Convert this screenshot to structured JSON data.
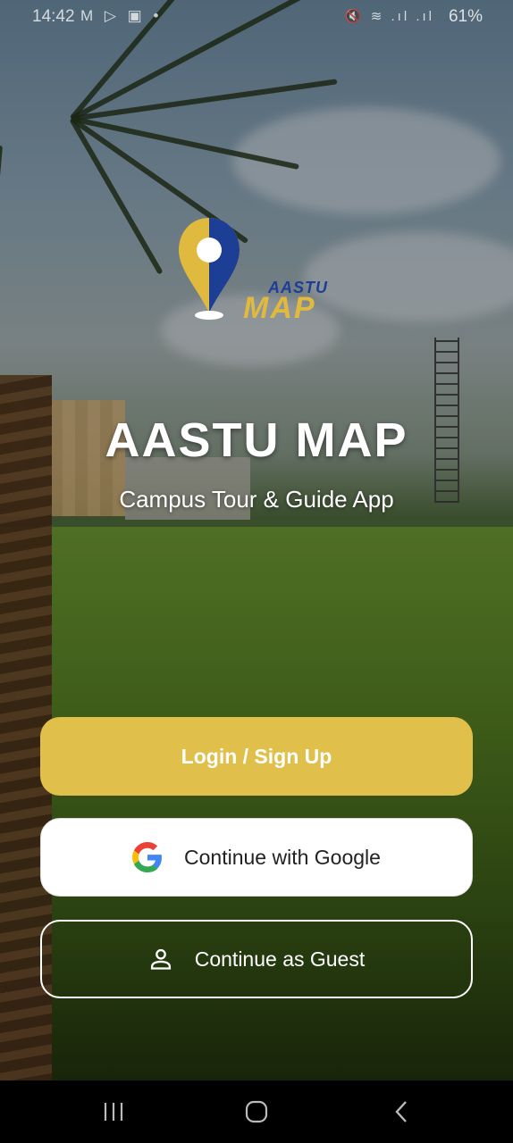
{
  "status_bar": {
    "time": "14:42",
    "left_icons": "M ▷ ▣ •",
    "right_icons": "🔇 ≋ .ıl .ıl",
    "battery": "61%"
  },
  "logo": {
    "small_text": "AASTU",
    "big_text": "MAP",
    "colors": {
      "navy": "#1d3e95",
      "gold": "#e0b93f"
    }
  },
  "app_title": "AASTU MAP",
  "app_subtitle": "Campus Tour & Guide App",
  "buttons": {
    "login": "Login / Sign Up",
    "google": "Continue with Google",
    "guest": "Continue as Guest"
  },
  "icons": {
    "google": "google-icon",
    "guest": "person-icon",
    "nav_recents": "recents-icon",
    "nav_home": "home-icon",
    "nav_back": "back-icon"
  },
  "colors": {
    "login_bg": "#e0bf4a",
    "google_bg": "#ffffff",
    "navbar_bg": "#000000"
  }
}
